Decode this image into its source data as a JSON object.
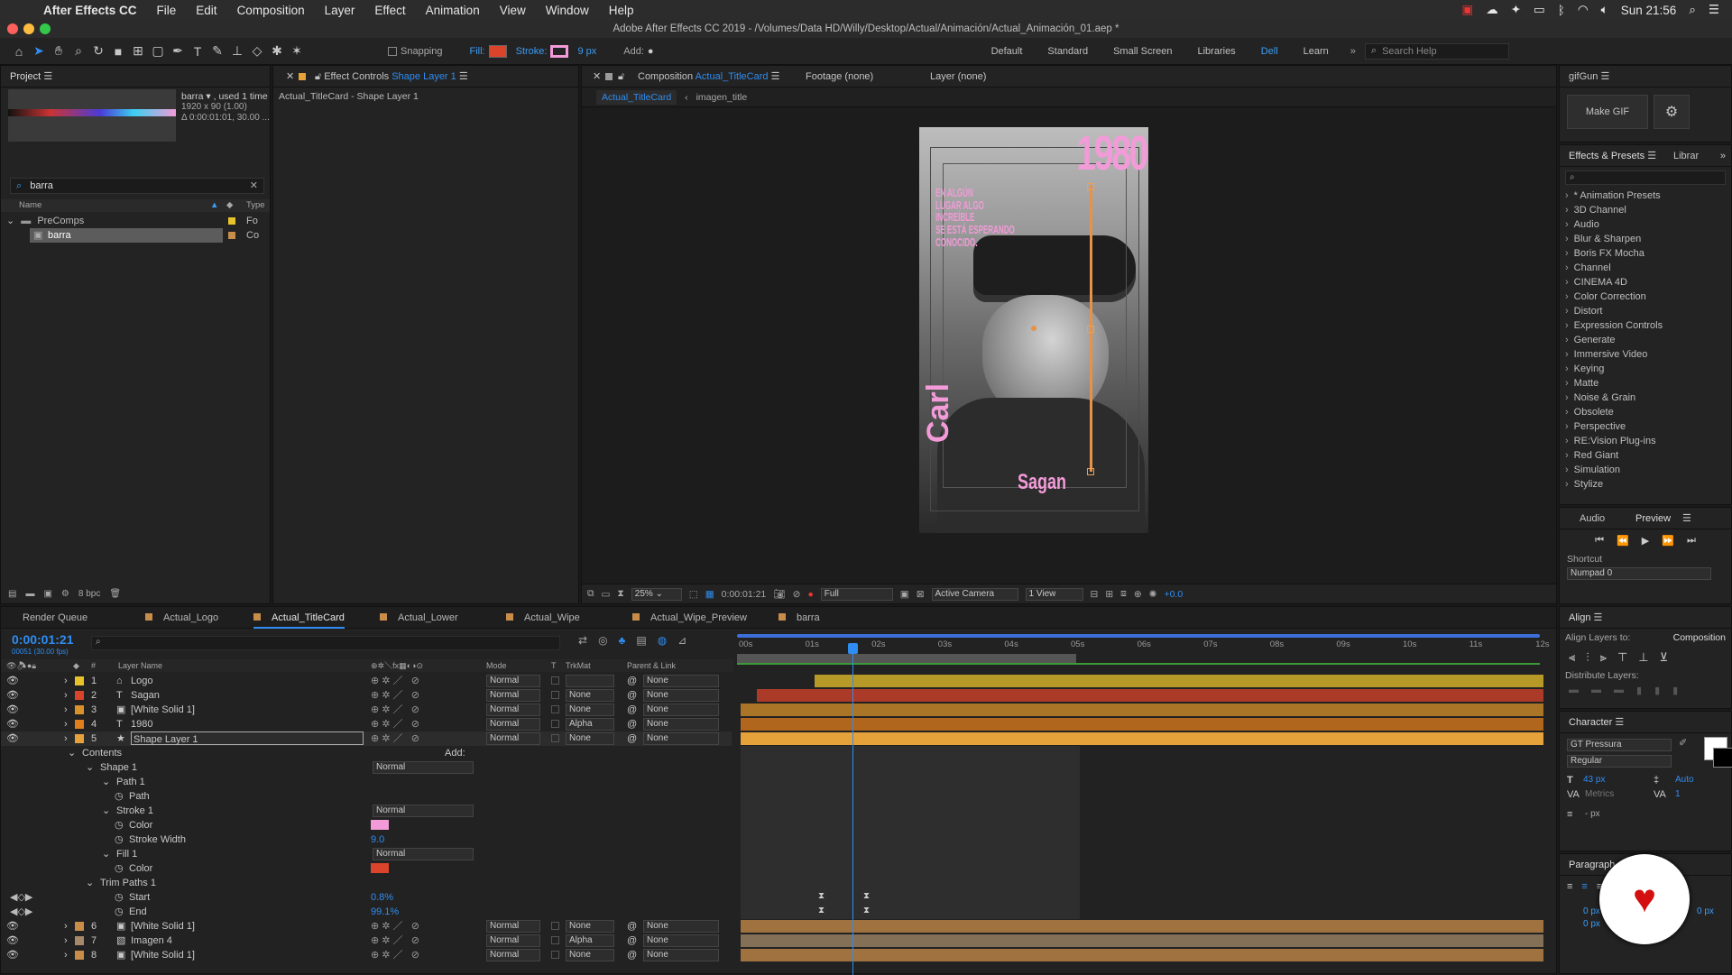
{
  "menubar": {
    "app": "After Effects CC",
    "items": [
      "File",
      "Edit",
      "Composition",
      "Layer",
      "Effect",
      "Animation",
      "View",
      "Window",
      "Help"
    ],
    "clock": "Sun 21:56"
  },
  "titlebar": {
    "title": "Adobe After Effects CC 2019 - /Volumes/Data HD/Willy/Desktop/Actual/Animación/Actual_Animación_01.aep *"
  },
  "toolbar": {
    "snapping": "Snapping",
    "fill": "Fill:",
    "stroke": "Stroke:",
    "stroke_px": "9 px",
    "add": "Add:",
    "workspaces": [
      "Default",
      "Standard",
      "Small Screen",
      "Libraries",
      "Dell",
      "Learn"
    ],
    "active_ws": "Dell",
    "search": "Search Help"
  },
  "project": {
    "title": "Project",
    "item_name": "barra ▾ , used 1 time",
    "item_size": "1920 x 90 (1.00)",
    "item_dur": "Δ 0:00:01:01, 30.00 ...",
    "search": "barra",
    "col_name": "Name",
    "col_type": "Type",
    "folder": "PreComps",
    "folder_type": "Fo",
    "item": "barra",
    "item_type": "Co",
    "bpc": "8 bpc"
  },
  "effects_controls": {
    "tab": "Effect Controls",
    "tab_layer": "Shape Layer 1",
    "subtitle": "Actual_TitleCard - Shape Layer 1"
  },
  "composition": {
    "tab": "Composition",
    "comp_name": "Actual_TitleCard",
    "footage": "Footage (none)",
    "layer": "Layer (none)",
    "crumb1": "Actual_TitleCard",
    "crumb2": "imagen_title",
    "zoom": "25%",
    "time": "0:00:01:21",
    "quality": "Full",
    "camera": "Active Camera",
    "views": "1 View",
    "exposure": "+0.0"
  },
  "poster": {
    "year": "1980",
    "quote": "EN ALGÚN\nLUGAR ALGO\nINCREÍBLE\nSE ESTÁ ESPERANDO\nCONOCIDO.",
    "name1": "Carl",
    "name2": "Sagan",
    "accent": "#f29bd8"
  },
  "gifgun": {
    "title": "gifGun",
    "make": "Make GIF"
  },
  "effects": {
    "tab": "Effects & Presets",
    "tab2": "Librar",
    "items": [
      "* Animation Presets",
      "3D Channel",
      "Audio",
      "Blur & Sharpen",
      "Boris FX Mocha",
      "Channel",
      "CINEMA 4D",
      "Color Correction",
      "Distort",
      "Expression Controls",
      "Generate",
      "Immersive Video",
      "Keying",
      "Matte",
      "Noise & Grain",
      "Obsolete",
      "Perspective",
      "RE:Vision Plug-ins",
      "Red Giant",
      "Simulation",
      "Stylize"
    ]
  },
  "preview": {
    "tab_audio": "Audio",
    "tab_preview": "Preview",
    "shortcut_label": "Shortcut",
    "shortcut_value": "Numpad 0"
  },
  "align": {
    "title": "Align",
    "align_to_label": "Align Layers to:",
    "align_to_value": "Composition",
    "distribute": "Distribute Layers:"
  },
  "character": {
    "title": "Character",
    "font": "GT Pressura",
    "style": "Regular",
    "size": "43 px",
    "leading": "Auto",
    "kerning": "Metrics",
    "tracking": "1",
    "unit": "- px"
  },
  "paragraph": {
    "title": "Paragraph",
    "indent1": "0 px",
    "indent2": "0 px",
    "indent3": "0 px"
  },
  "timeline": {
    "tabs": [
      "Render Queue",
      "Actual_Logo",
      "Actual_TitleCard",
      "Actual_Lower",
      "Actual_Wipe",
      "Actual_Wipe_Preview",
      "barra"
    ],
    "active_tab": "Actual_TitleCard",
    "timecode": "0:00:01:21",
    "frames": "00051 (30.00 fps)",
    "headers": {
      "layer_name": "Layer Name",
      "mode": "Mode",
      "t": "T",
      "trkmat": "TrkMat",
      "parent": "Parent & Link"
    },
    "ticks": [
      "00s",
      "01s",
      "02s",
      "03s",
      "04s",
      "05s",
      "06s",
      "07s",
      "08s",
      "09s",
      "10s",
      "11s",
      "12s"
    ],
    "layers": [
      {
        "num": "1",
        "type": "logo",
        "name": "Logo",
        "mode": "Normal",
        "trkmat": "",
        "parent": "None",
        "color": "#e8c22a"
      },
      {
        "num": "2",
        "type": "T",
        "name": "Sagan",
        "mode": "Normal",
        "trkmat": "None",
        "parent": "None",
        "color": "#d9442b"
      },
      {
        "num": "3",
        "type": "solid",
        "name": "[White Solid 1]",
        "mode": "Normal",
        "trkmat": "None",
        "parent": "None",
        "color": "#d9912b"
      },
      {
        "num": "4",
        "type": "T",
        "name": "1980",
        "mode": "Normal",
        "trkmat": "Alpha",
        "parent": "None",
        "color": "#e07e1c"
      },
      {
        "num": "5",
        "type": "star",
        "name": "Shape Layer 1",
        "mode": "Normal",
        "trkmat": "None",
        "parent": "None",
        "color": "#e6a23a"
      }
    ],
    "props": {
      "contents": "Contents",
      "add": "Add:",
      "shape1": "Shape 1",
      "shape1_mode": "Normal",
      "path1": "Path 1",
      "path": "Path",
      "stroke1": "Stroke 1",
      "stroke1_mode": "Normal",
      "color": "Color",
      "stroke_width": "Stroke Width",
      "stroke_width_val": "9.0",
      "fill1": "Fill 1",
      "fill1_mode": "Normal",
      "fill_color": "Color",
      "trim": "Trim Paths 1",
      "start": "Start",
      "start_val": "0.8%",
      "end": "End",
      "end_val": "99.1%"
    },
    "layers2": [
      {
        "num": "6",
        "type": "solid",
        "name": "[White Solid 1]",
        "mode": "Normal",
        "trkmat": "None",
        "parent": "None",
        "color": "#c98d4a"
      },
      {
        "num": "7",
        "type": "img",
        "name": "Imagen 4",
        "mode": "Normal",
        "trkmat": "Alpha",
        "parent": "None",
        "color": "#a5896a"
      },
      {
        "num": "8",
        "type": "solid",
        "name": "[White Solid 1]",
        "mode": "Normal",
        "trkmat": "None",
        "parent": "None",
        "color": "#c98d4a"
      }
    ]
  },
  "colors": {
    "accent": "#2f8df2",
    "pink": "#f29bd8",
    "fillred": "#d9442b"
  }
}
